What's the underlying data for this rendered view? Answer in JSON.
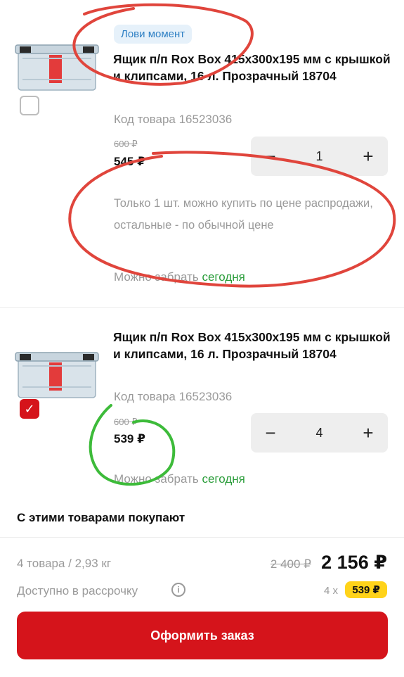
{
  "products": [
    {
      "promo_badge": "Лови момент",
      "title": "Ящик п/п Rox Box 415x300x195 мм с крышкой и клипсами, 16 л. Прозрачный 18704",
      "sku": "Код товара 16523036",
      "old_price": "600 ₽",
      "price": "545 ₽",
      "quantity": "1",
      "minus": "−",
      "plus": "+",
      "selected": false,
      "note": "Только 1 шт. можно купить по цене распродажи, остальные - по обычной цене",
      "pickup_label": "Можно забрать",
      "pickup_when": "сегодня"
    },
    {
      "title": "Ящик п/п Rox Box 415x300x195 мм с крышкой и клипсами, 16 л. Прозрачный 18704",
      "sku": "Код товара 16523036",
      "old_price": "600 ₽",
      "price": "539 ₽",
      "quantity": "4",
      "minus": "−",
      "plus": "+",
      "selected": true,
      "pickup_label": "Можно забрать",
      "pickup_when": "сегодня"
    }
  ],
  "also_bought": "С этими товарами покупают",
  "summary": {
    "count_weight": "4 товара / 2,93 кг",
    "old_total": "2 400 ₽",
    "total": "2 156 ₽",
    "installment_label": "Доступно в рассрочку",
    "installment_multiplier": "4 х",
    "installment_amount": "539 ₽"
  },
  "order_button": "Оформить заказ",
  "colors": {
    "accent_red": "#d5141b",
    "promo_blue": "#2f80c4",
    "pickup_green": "#2a9d3a",
    "installment_yellow": "#ffd31a",
    "annotation_red": "#e0453c",
    "annotation_green": "#3dbb3a"
  },
  "icons": {
    "info": "info-icon",
    "checkmark": "check-icon"
  }
}
